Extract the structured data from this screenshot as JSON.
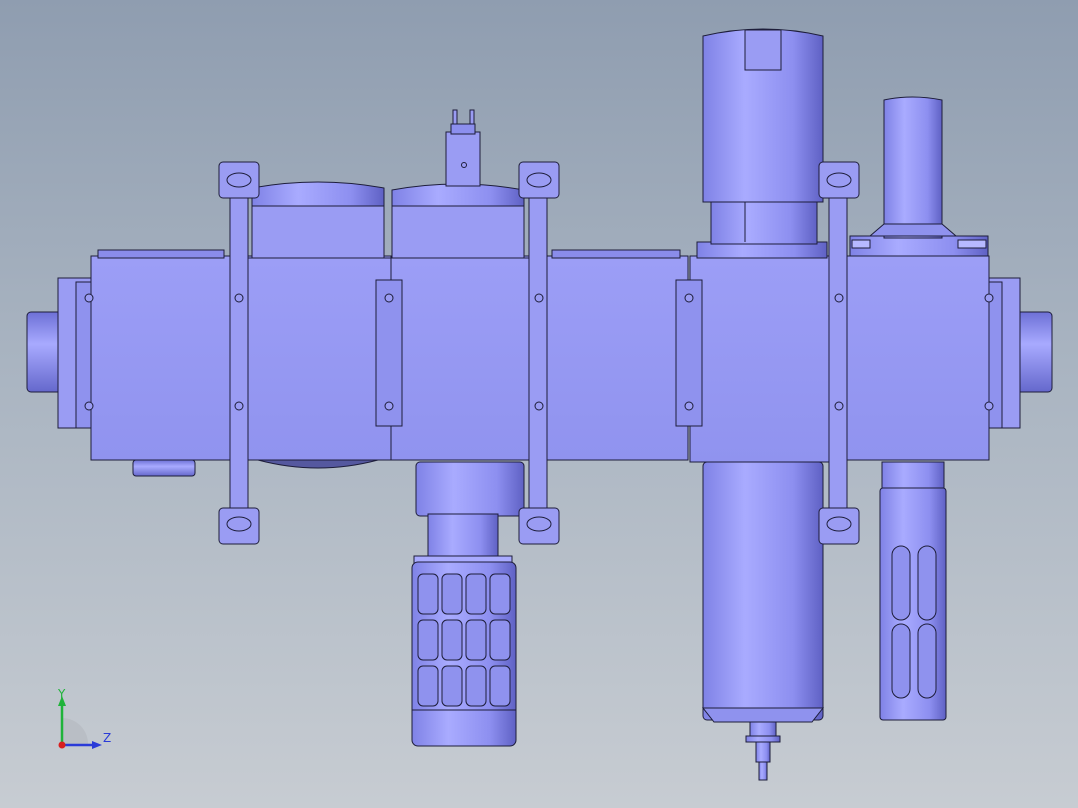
{
  "viewport": {
    "background_top": "#8f9db0",
    "background_bottom": "#c7ccd2",
    "part_color": "#9a9cf3",
    "part_edge": "#1d1d3a"
  },
  "triad": {
    "y_label": "Y",
    "z_label": "Z",
    "y_color": "#1fb33a",
    "z_color": "#2a3bd8",
    "origin_color": "#d81f1f"
  }
}
